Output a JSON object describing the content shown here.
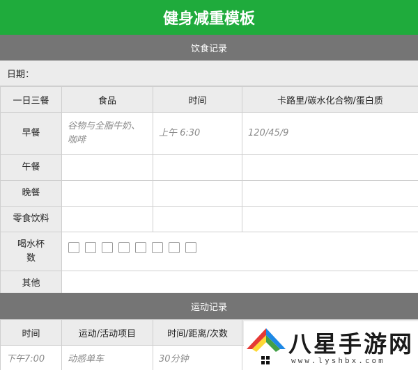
{
  "title": "健身减重模板",
  "diet": {
    "section_title": "饮食记录",
    "date_label": "日期：",
    "headers": [
      "一日三餐",
      "食品",
      "时间",
      "卡路里/碳水化合物/蛋白质"
    ],
    "rows": [
      {
        "label": "早餐",
        "food": "谷物与全脂牛奶、咖啡",
        "time": "上午 6:30",
        "calories": "120/45/9"
      },
      {
        "label": "午餐",
        "food": "",
        "time": "",
        "calories": ""
      },
      {
        "label": "晚餐",
        "food": "",
        "time": "",
        "calories": ""
      },
      {
        "label": "零食饮料",
        "food": "",
        "time": "",
        "calories": ""
      }
    ],
    "water_label": "喝水杯数",
    "water_cups": 8,
    "water_checked": 0,
    "other_label": "其他"
  },
  "exercise": {
    "section_title": "运动记录",
    "headers": [
      "时间",
      "运动/活动项目",
      "时间/距离/次数",
      ""
    ],
    "rows": [
      {
        "time": "下午7:00",
        "activity": "动感单车",
        "duration": "30分钟",
        "extra": ""
      }
    ]
  },
  "watermark": {
    "name": "八星手游网",
    "url": "www.lyshbx.com"
  }
}
